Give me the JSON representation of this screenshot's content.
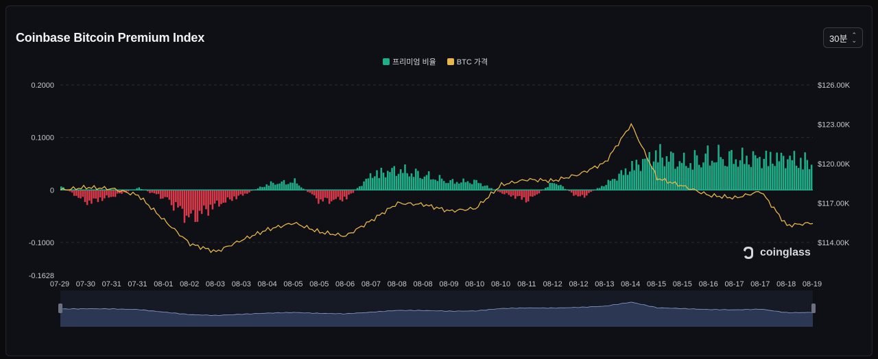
{
  "header": {
    "title": "Coinbase Bitcoin Premium Index",
    "interval": "30분"
  },
  "legend": {
    "premium": "프리미엄 비율",
    "btc": "BTC 가격"
  },
  "brand": {
    "name": "coinglass",
    "icon": "coinglass-logo-icon"
  },
  "colors": {
    "positive": "#1fae8a",
    "negative": "#d83a4a",
    "btc_line": "#e8b64a",
    "navigator_fill": "#2c3956",
    "navigator_line": "#8a9fcf"
  },
  "chart_data": {
    "type": "bar",
    "title": "Coinbase Bitcoin Premium Index",
    "x": [
      "07-29",
      "07-30",
      "07-31",
      "07-31",
      "08-01",
      "08-02",
      "08-03",
      "08-03",
      "08-04",
      "08-05",
      "08-05",
      "08-06",
      "08-07",
      "08-08",
      "08-08",
      "08-09",
      "08-10",
      "08-10",
      "08-11",
      "08-12",
      "08-12",
      "08-13",
      "08-14",
      "08-15",
      "08-15",
      "08-16",
      "08-17",
      "08-17",
      "08-18",
      "08-19"
    ],
    "y_left": {
      "ylim": [
        -0.1628,
        0.2
      ],
      "ticks": [
        "0.2000",
        "0.1000",
        "0",
        "-0.1000",
        "-0.1628"
      ]
    },
    "y_right": {
      "ylim": [
        111500,
        126000
      ],
      "ticks": [
        "$126.00K",
        "$123.00K",
        "$120.00K",
        "$117.00K",
        "$114.00K"
      ]
    },
    "series": [
      {
        "name": "프리미엄 비율",
        "kind": "bar",
        "values": [
          0.008,
          -0.03,
          -0.015,
          0.005,
          -0.02,
          -0.07,
          -0.035,
          -0.012,
          0.015,
          0.02,
          -0.028,
          -0.02,
          0.038,
          0.048,
          0.035,
          0.02,
          0.02,
          -0.008,
          -0.025,
          0.02,
          -0.02,
          0.015,
          0.055,
          0.085,
          0.065,
          0.08,
          0.075,
          0.075,
          0.075,
          0.065
        ]
      },
      {
        "name": "BTC 가격",
        "kind": "line",
        "values": [
          118000,
          118200,
          118100,
          117600,
          115700,
          113900,
          113300,
          114200,
          115000,
          115500,
          114800,
          114500,
          115700,
          117000,
          116900,
          116400,
          116600,
          118400,
          118800,
          118700,
          119200,
          120100,
          123000,
          118900,
          118300,
          117600,
          117400,
          117900,
          115300,
          115500
        ]
      }
    ],
    "grid": true,
    "legend_position": "top-center",
    "navigator": true
  }
}
